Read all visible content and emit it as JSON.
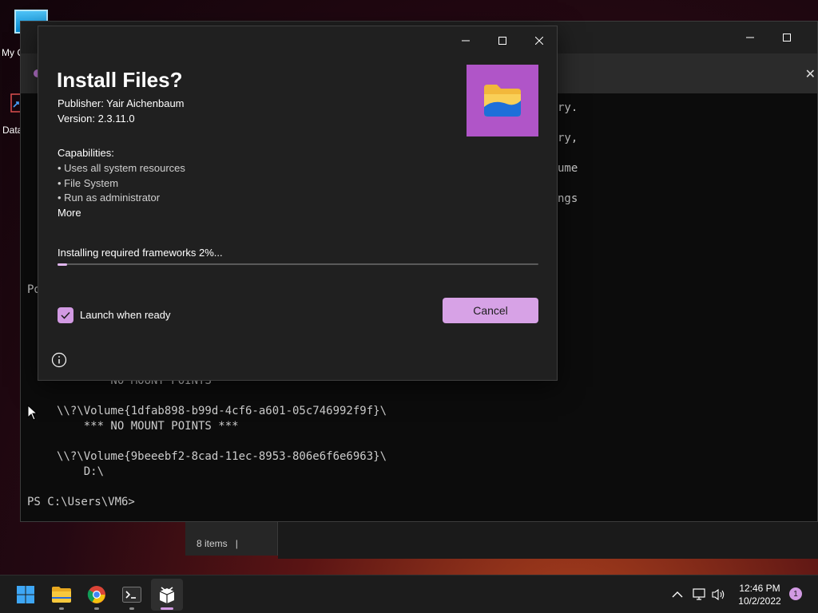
{
  "desktop": {
    "icons": [
      {
        "label": "My C",
        "icon": "monitor-icon"
      },
      {
        "label": "Data",
        "icon": "shortcut-icon"
      }
    ]
  },
  "explorer": {
    "status": "8 items",
    "cursor": "|"
  },
  "terminal": {
    "lines_right": [
      "ry.",
      "ry,",
      "ume",
      "ngs"
    ],
    "prompt_partial": "Po",
    "output": [
      "    *** NO MOUNT POINTS ***",
      "\\\\?\\Volume{1dfab898-b99d-4cf6-a601-05c746992f9f}\\",
      "    *** NO MOUNT POINTS ***",
      "",
      "\\\\?\\Volume{9beeebf2-8cad-11ec-8953-806e6f6e6963}\\",
      "    D:\\",
      "",
      "PS C:\\Users\\VM6>"
    ]
  },
  "dialog": {
    "title": "Install Files?",
    "publisher": "Publisher: Yair Aichenbaum",
    "version": "Version: 2.3.11.0",
    "capabilities_heading": "Capabilities:",
    "capabilities": [
      "• Uses all system resources",
      "• File System",
      "• Run as administrator"
    ],
    "more_link": "More",
    "progress_label": "Installing required frameworks 2%...",
    "progress_fraction": 0.02,
    "launch_checkbox": {
      "label": "Launch when ready",
      "checked": true
    },
    "cancel_label": "Cancel",
    "app_icon": "folder-icon",
    "accent": "#d7a2e6",
    "tile_color": "#b055c8"
  },
  "taskbar": {
    "apps": [
      "windows-start-icon",
      "file-explorer-icon",
      "chrome-icon",
      "terminal-icon",
      "installer-icon"
    ],
    "tray": [
      "chevron-up-icon",
      "network-icon",
      "volume-icon"
    ],
    "time": "12:46 PM",
    "date": "10/2/2022",
    "notification_count": "1"
  }
}
